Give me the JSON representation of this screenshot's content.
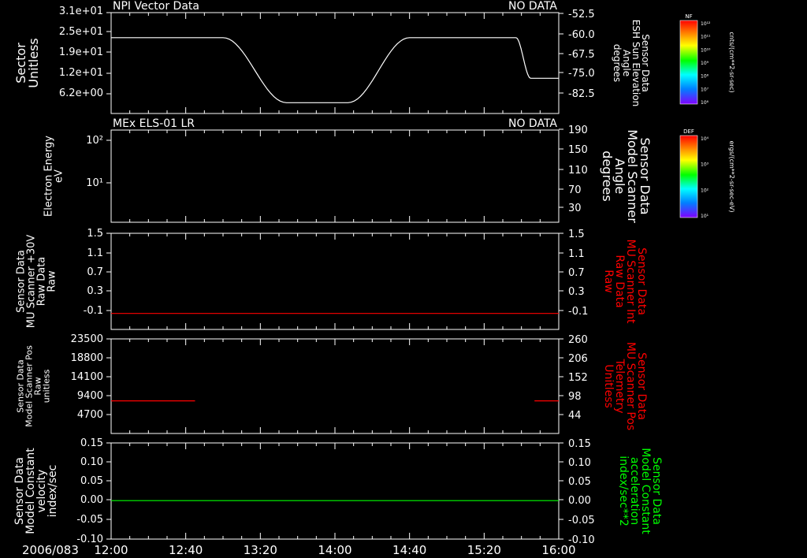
{
  "date_label": "2006/083",
  "x_ticks": [
    "12:00",
    "12:40",
    "13:20",
    "14:00",
    "14:40",
    "15:20",
    "16:00"
  ],
  "colors": {
    "background": "#000000",
    "axes": "#ffffff",
    "line_white": "#ffffff",
    "line_red": "#ff0000",
    "line_green": "#00ff00"
  },
  "colorbars": [
    {
      "top_label": "NF",
      "ticks": [
        "10¹²",
        "10¹¹",
        "10¹⁰",
        "10⁹",
        "10⁸",
        "10⁷",
        "10⁶"
      ],
      "unit": "cnts/(cm**2-sr-sec)"
    },
    {
      "top_label": "DEF",
      "ticks": [
        "10⁴",
        "10³",
        "10²",
        "10¹"
      ],
      "unit": "ergs/(cm**2-sr-sec-eV)"
    }
  ],
  "chart_data": [
    {
      "type": "line",
      "title": "NPI Vector Data",
      "status": "NO DATA",
      "left_label": [
        "Sector",
        "Unitless"
      ],
      "left_ticks": [
        "3.1e+01",
        "2.5e+01",
        "1.9e+01",
        "1.2e+01",
        "6.2e+00"
      ],
      "right_label": [
        "Sensor Data",
        "ESH Sun Elevation",
        "Angle",
        "degrees"
      ],
      "right_ticks": [
        "-52.5",
        "-60.0",
        "-67.5",
        "-75.0",
        "-82.5"
      ],
      "series": [
        {
          "color": "#ffffff",
          "x": [
            "12:00",
            "13:00",
            "13:34",
            "14:07",
            "14:40",
            "15:37",
            "15:45",
            "16:00"
          ],
          "y": [
            -60.0,
            -60.0,
            -84.0,
            -84.0,
            -60.0,
            -60.0,
            -75.0,
            -75.0
          ]
        }
      ],
      "right_ylim": [
        -52.5,
        -88.0
      ]
    },
    {
      "type": "line",
      "title": "MEx ELS-01 LR",
      "status": "NO DATA",
      "left_label": [
        "Electron Energy",
        "eV"
      ],
      "left_ticks": [
        "10²",
        "10¹"
      ],
      "right_label": [
        "Sensor Data",
        "Model Scanner",
        "Angle",
        "degrees"
      ],
      "right_ticks": [
        "190",
        "150",
        "110",
        "70",
        "30"
      ],
      "series": []
    },
    {
      "type": "line",
      "left_label": [
        "Sensor Data",
        "MU Scanner +30V",
        "Raw Data",
        "Raw"
      ],
      "left_ticks": [
        "1.5",
        "1.1",
        "0.7",
        "0.3",
        "-0.1"
      ],
      "right_label": [
        "Sensor Data",
        "MU Scanner Int",
        "Raw Data",
        "Raw"
      ],
      "right_ticks": [
        "1.5",
        "1.1",
        "0.7",
        "0.3",
        "-0.1"
      ],
      "series": [
        {
          "color": "#ff0000",
          "x": [
            "12:00",
            "16:00"
          ],
          "y": [
            0.0,
            0.0
          ]
        }
      ],
      "ylim": [
        1.5,
        -0.3
      ]
    },
    {
      "type": "line",
      "left_label": [
        "Sensor Data",
        "Model Scanner Pos",
        "Raw",
        "unitless"
      ],
      "left_ticks": [
        "23500",
        "18800",
        "14100",
        "9400",
        "4700"
      ],
      "right_label": [
        "Sensor Data",
        "MU Scanner Pos",
        "Telemetry",
        "Unitless"
      ],
      "right_ticks": [
        "260",
        "206",
        "152",
        "98",
        "44"
      ],
      "series": [
        {
          "color": "#ff0000",
          "x": [
            "12:00",
            "12:45"
          ],
          "y": [
            8100,
            8100
          ]
        },
        {
          "color": "#ff0000",
          "x": [
            "15:47",
            "16:00"
          ],
          "y": [
            8100,
            8100
          ]
        }
      ],
      "ylim": [
        23500,
        0
      ]
    },
    {
      "type": "line",
      "left_label": [
        "Sensor Data",
        "Model Constant",
        "velocity",
        "index/sec"
      ],
      "left_ticks": [
        "0.15",
        "0.10",
        "0.05",
        "0.00",
        "-0.05",
        "-0.10"
      ],
      "right_label": [
        "Sensor Data",
        "Model Constant",
        "acceleration",
        "index/sec**2"
      ],
      "right_ticks": [
        "0.15",
        "0.10",
        "0.05",
        "0.00",
        "-0.05",
        "-0.10"
      ],
      "series": [
        {
          "color": "#00ff00",
          "x": [
            "12:00",
            "16:00"
          ],
          "y": [
            0.0,
            0.0
          ]
        }
      ],
      "ylim": [
        0.15,
        -0.1
      ]
    }
  ]
}
